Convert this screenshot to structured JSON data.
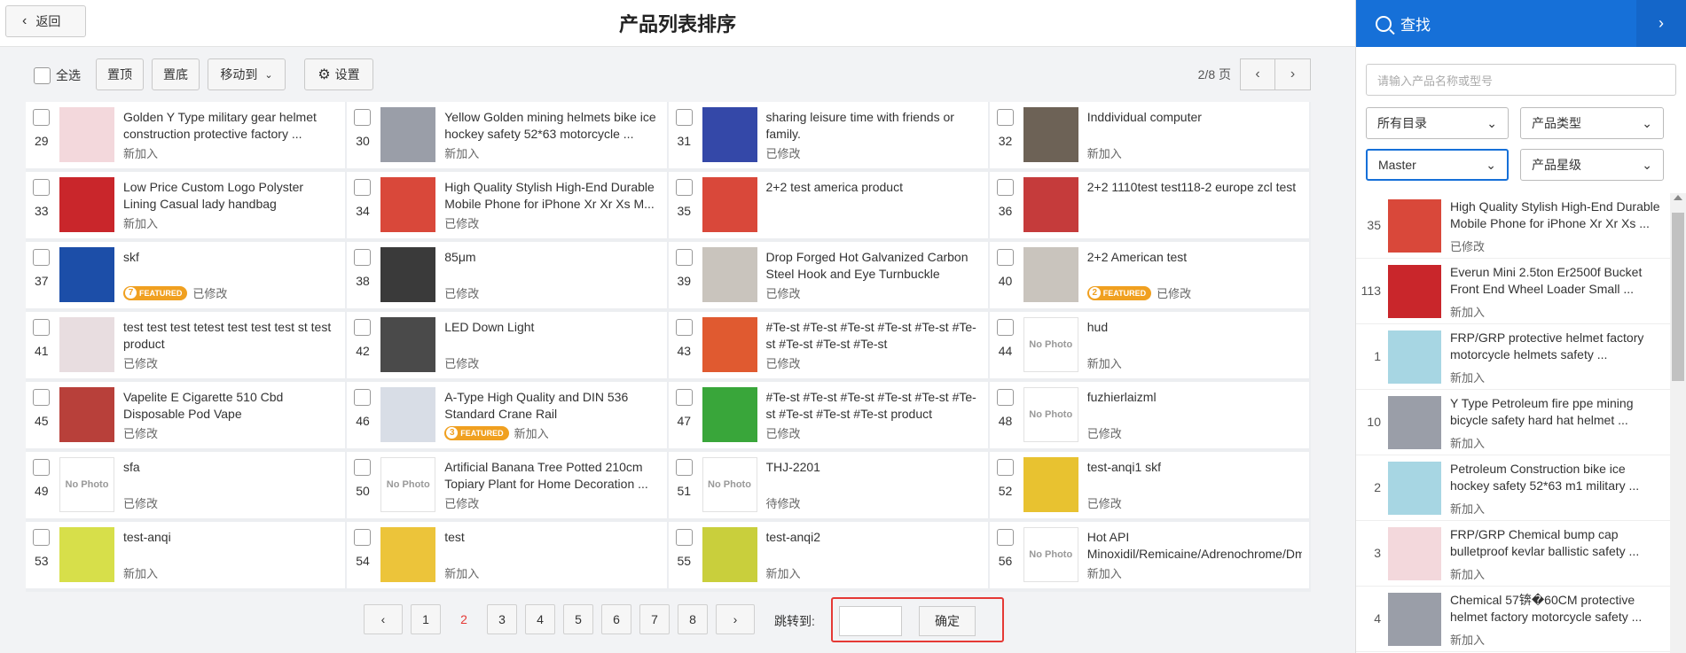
{
  "header": {
    "back_label": "返回",
    "title": "产品列表排序"
  },
  "toolbar": {
    "select_all": "全选",
    "top_btn": "置顶",
    "bottom_btn": "置底",
    "move_btn": "移动到",
    "settings_btn": "设置",
    "page_info": "2/8 页"
  },
  "products": [
    {
      "num": "29",
      "name": "Golden Y Type military gear helmet construction protective factory ...",
      "status": "新加入",
      "thumb": "#f3d8dc",
      "nophoto": false,
      "featured": ""
    },
    {
      "num": "30",
      "name": "Yellow Golden mining helmets bike ice hockey safety 52*63 motorcycle ...",
      "status": "新加入",
      "thumb": "#9a9ea8",
      "nophoto": false,
      "featured": ""
    },
    {
      "num": "31",
      "name": "sharing leisure time with friends or family.",
      "status": "已修改",
      "thumb": "#3448a8",
      "nophoto": false,
      "featured": ""
    },
    {
      "num": "32",
      "name": "Inddividual computer",
      "status": "新加入",
      "thumb": "#6d6256",
      "nophoto": false,
      "featured": ""
    },
    {
      "num": "33",
      "name": "Low Price Custom Logo Polyster Lining Casual lady handbag",
      "status": "新加入",
      "thumb": "#c9262b",
      "nophoto": false,
      "featured": ""
    },
    {
      "num": "34",
      "name": "High Quality Stylish High-End Durable Mobile Phone for iPhone Xr Xr Xs M...",
      "status": "已修改",
      "thumb": "#d9483a",
      "nophoto": false,
      "featured": ""
    },
    {
      "num": "35",
      "name": "2+2 test america product",
      "status": "",
      "thumb": "#d9483a",
      "nophoto": false,
      "featured": ""
    },
    {
      "num": "36",
      "name": "2+2 1110test test118-2 europe zcl test",
      "status": "",
      "thumb": "#c53b3b",
      "nophoto": false,
      "featured": ""
    },
    {
      "num": "37",
      "name": "skf",
      "status": "已修改",
      "thumb": "#1c4ea8",
      "nophoto": false,
      "featured": "7"
    },
    {
      "num": "38",
      "name": "85μm",
      "status": "已修改",
      "thumb": "#3a3a3a",
      "nophoto": false,
      "featured": ""
    },
    {
      "num": "39",
      "name": "Drop Forged Hot Galvanized Carbon Steel Hook and Eye Turnbuckle",
      "status": "已修改",
      "thumb": "#c9c4bd",
      "nophoto": false,
      "featured": ""
    },
    {
      "num": "40",
      "name": "2+2 American test",
      "status": "已修改",
      "thumb": "#c9c4bd",
      "nophoto": false,
      "featured": "2"
    },
    {
      "num": "41",
      "name": "test test test tetest test test test st test product",
      "status": "已修改",
      "thumb": "#e8dde0",
      "nophoto": false,
      "featured": ""
    },
    {
      "num": "42",
      "name": "LED Down Light",
      "status": "已修改",
      "thumb": "#4a4a4a",
      "nophoto": false,
      "featured": ""
    },
    {
      "num": "43",
      "name": "#Te-st #Te-st #Te-st #Te-st #Te-st #Te-st #Te-st #Te-st #Te-st",
      "status": "已修改",
      "thumb": "#e05a30",
      "nophoto": false,
      "featured": ""
    },
    {
      "num": "44",
      "name": "hud",
      "status": "新加入",
      "thumb": "",
      "nophoto": true,
      "featured": ""
    },
    {
      "num": "45",
      "name": "Vapelite E Cigarette 510 Cbd Disposable Pod Vape",
      "status": "已修改",
      "thumb": "#b8403a",
      "nophoto": false,
      "featured": ""
    },
    {
      "num": "46",
      "name": "A-Type High Quality and DIN 536 Standard Crane Rail",
      "status": "新加入",
      "thumb": "#d8dde6",
      "nophoto": false,
      "featured": "3"
    },
    {
      "num": "47",
      "name": "#Te-st #Te-st #Te-st #Te-st #Te-st #Te-st #Te-st #Te-st #Te-st product",
      "status": "已修改",
      "thumb": "#39a63a",
      "nophoto": false,
      "featured": ""
    },
    {
      "num": "48",
      "name": "fuzhierlaizml",
      "status": "已修改",
      "thumb": "",
      "nophoto": true,
      "featured": ""
    },
    {
      "num": "49",
      "name": "sfa",
      "status": "已修改",
      "thumb": "",
      "nophoto": true,
      "featured": ""
    },
    {
      "num": "50",
      "name": "Artificial Banana Tree Potted 210cm Topiary Plant for Home Decoration ...",
      "status": "已修改",
      "thumb": "",
      "nophoto": true,
      "featured": ""
    },
    {
      "num": "51",
      "name": "THJ-2201",
      "status": "待修改",
      "thumb": "",
      "nophoto": true,
      "featured": ""
    },
    {
      "num": "52",
      "name": "test-anqi1 skf",
      "status": "已修改",
      "thumb": "#e8c230",
      "nophoto": false,
      "featured": ""
    },
    {
      "num": "53",
      "name": "test-anqi",
      "status": "新加入",
      "thumb": "#d7df4a",
      "nophoto": false,
      "featured": ""
    },
    {
      "num": "54",
      "name": "test",
      "status": "新加入",
      "thumb": "#ecc43a",
      "nophoto": false,
      "featured": ""
    },
    {
      "num": "55",
      "name": "test-anqi2",
      "status": "新加入",
      "thumb": "#c9cf3c",
      "nophoto": false,
      "featured": ""
    },
    {
      "num": "56",
      "name": "Hot API Minoxidil/Remicaine/Adrenochrome/Dmha/...",
      "status": "新加入",
      "thumb": "",
      "nophoto": true,
      "featured": ""
    }
  ],
  "featured_text": "FEATURED",
  "nophoto_text": "No Photo",
  "pager": {
    "pages": [
      "1",
      "2",
      "3",
      "4",
      "5",
      "6",
      "7",
      "8"
    ],
    "current": "2",
    "prev": "‹",
    "next": "›",
    "jump_label": "跳转到:",
    "jump_value": "",
    "ok_label": "确定"
  },
  "panel": {
    "title": "查找",
    "close": "›",
    "search_placeholder": "请输入产品名称或型号",
    "sel_catalog": "所有目录",
    "sel_type": "产品类型",
    "sel_master": "Master",
    "sel_star": "产品星级",
    "items": [
      {
        "num": "35",
        "name": "High Quality Stylish High-End Durable Mobile Phone for iPhone Xr Xr Xs ...",
        "status": "已修改",
        "thumb": "#d9483a"
      },
      {
        "num": "113",
        "name": "Everun Mini 2.5ton Er2500f Bucket Front End Wheel Loader Small ...",
        "status": "新加入",
        "thumb": "#c9262b"
      },
      {
        "num": "1",
        "name": "FRP/GRP protective helmet factory motorcycle helmets safety ...",
        "status": "新加入",
        "thumb": "#a7d6e3"
      },
      {
        "num": "10",
        "name": "Y Type Petroleum fire ppe mining bicycle safety hard hat helmet ...",
        "status": "新加入",
        "thumb": "#9a9ea8"
      },
      {
        "num": "2",
        "name": "Petroleum Construction bike ice hockey safety 52*63 m1 military ...",
        "status": "新加入",
        "thumb": "#a7d6e3"
      },
      {
        "num": "3",
        "name": "FRP/GRP Chemical bump cap bulletproof kevlar ballistic safety ...",
        "status": "新加入",
        "thumb": "#f3d8dc"
      },
      {
        "num": "4",
        "name": "Chemical 57锛�60CM protective helmet factory motorcycle safety ...",
        "status": "新加入",
        "thumb": "#9a9ea8"
      }
    ]
  }
}
